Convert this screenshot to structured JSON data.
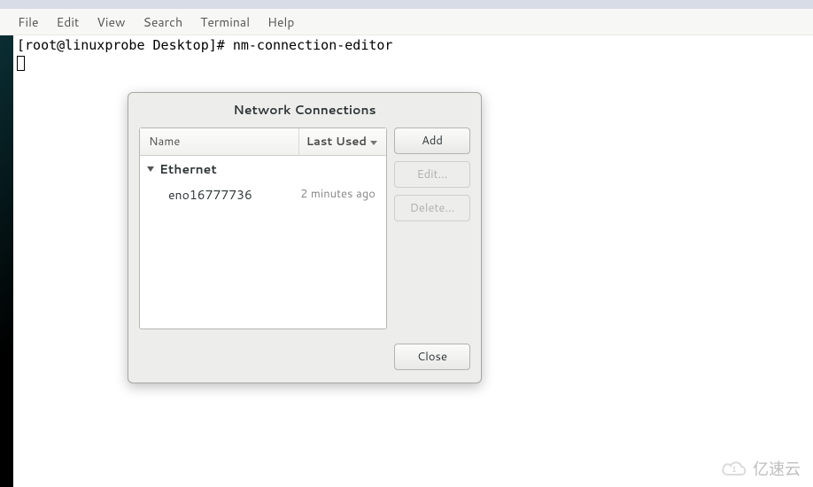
{
  "menubar": {
    "items": [
      "File",
      "Edit",
      "View",
      "Search",
      "Terminal",
      "Help"
    ]
  },
  "terminal": {
    "prompt": "[root@linuxprobe Desktop]# ",
    "command": "nm-connection-editor"
  },
  "dialog": {
    "title": "Network Connections",
    "columns": {
      "name": "Name",
      "last_used": "Last Used"
    },
    "group": "Ethernet",
    "rows": [
      {
        "name": "eno16777736",
        "last_used": "2 minutes ago"
      }
    ],
    "buttons": {
      "add": "Add",
      "edit": "Edit...",
      "delete": "Delete...",
      "close": "Close"
    }
  },
  "watermark": {
    "text": "亿速云"
  }
}
